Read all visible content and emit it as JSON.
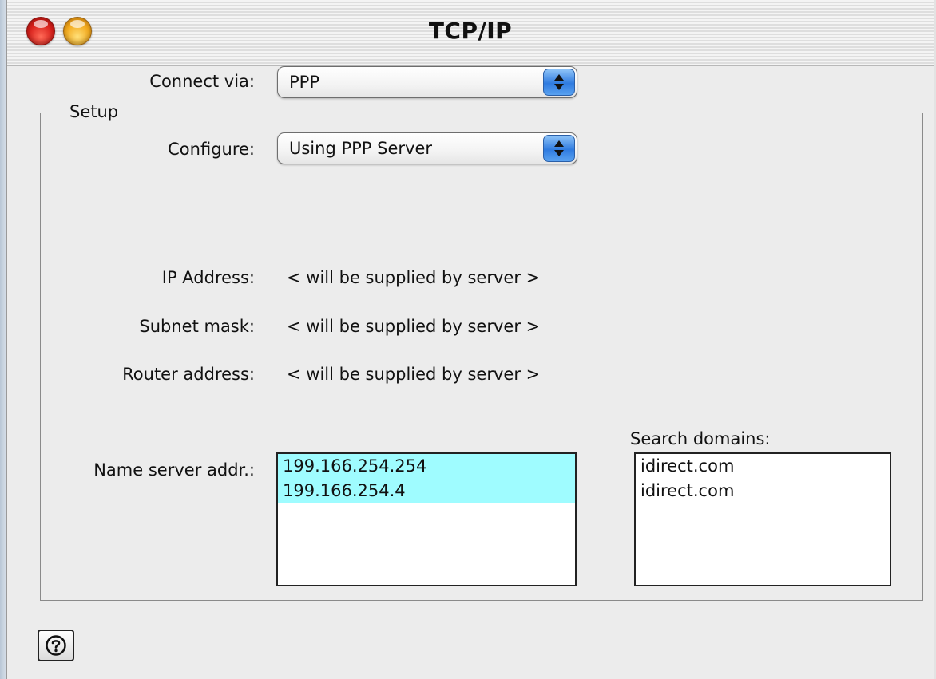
{
  "window": {
    "title": "TCP/IP"
  },
  "connect_via": {
    "label": "Connect via:",
    "value": "PPP"
  },
  "setup": {
    "group_title": "Setup",
    "configure": {
      "label": "Configure:",
      "value": "Using PPP Server"
    },
    "ip_address": {
      "label": "IP Address:",
      "value": "< will be supplied by server >"
    },
    "subnet_mask": {
      "label": "Subnet mask:",
      "value": "< will be supplied by server >"
    },
    "router_address": {
      "label": "Router address:",
      "value": "< will be supplied by server >"
    },
    "name_servers": {
      "label": "Name server addr.:",
      "items": [
        "199.166.254.254",
        "199.166.254.4"
      ]
    },
    "search_domains": {
      "label": "Search domains:",
      "items": [
        "idirect.com",
        "idirect.com"
      ]
    }
  },
  "help_button": {
    "icon": "question-circle-icon"
  },
  "colors": {
    "selection": "#9ffcff",
    "close_button": "#d91f1a",
    "minimize_button": "#f3a91c",
    "popup_arrows": "#2f7be0"
  }
}
